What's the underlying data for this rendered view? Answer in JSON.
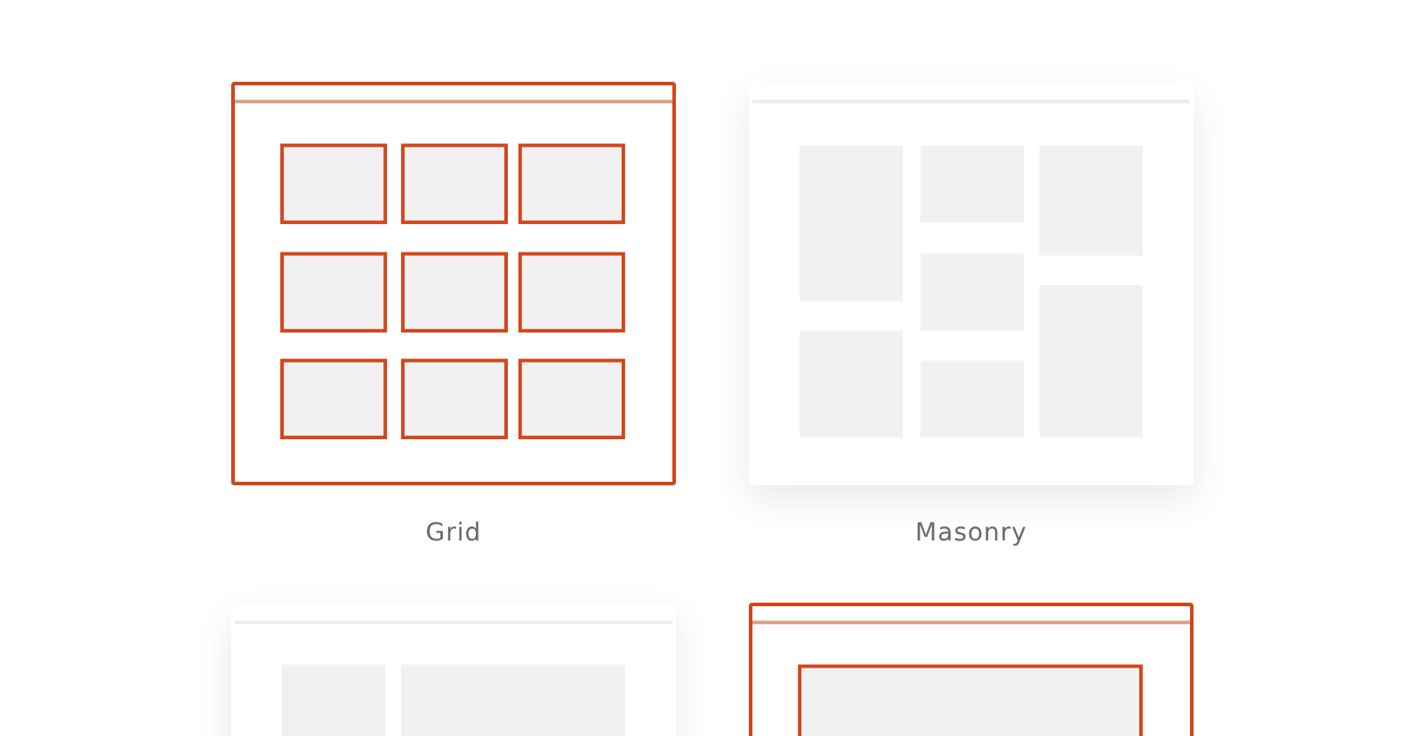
{
  "layouts": [
    {
      "kind": "grid",
      "label": "Grid",
      "selected": true
    },
    {
      "kind": "masonry",
      "label": "Masonry",
      "selected": false
    },
    {
      "kind": "sidebar",
      "selected": false
    },
    {
      "kind": "single",
      "selected": true
    }
  ]
}
